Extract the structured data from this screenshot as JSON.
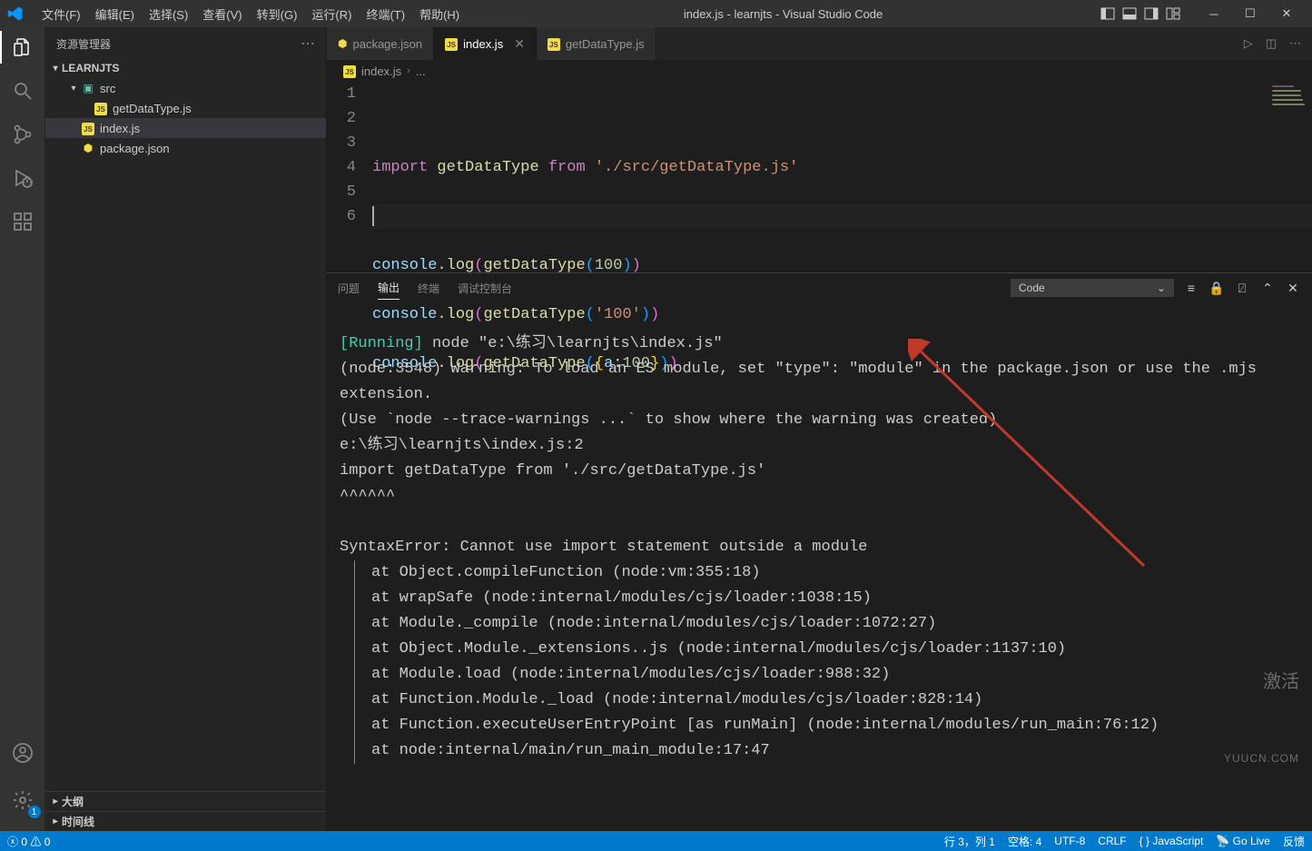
{
  "window": {
    "title": "index.js - learnjts - Visual Studio Code"
  },
  "menu": {
    "items": [
      "文件(F)",
      "编辑(E)",
      "选择(S)",
      "查看(V)",
      "转到(G)",
      "运行(R)",
      "终端(T)",
      "帮助(H)"
    ]
  },
  "sidebar": {
    "title": "资源管理器",
    "project": "LEARNJTS",
    "tree": {
      "folder_src": "src",
      "file_getdatatype": "getDataType.js",
      "file_index": "index.js",
      "file_package": "package.json"
    },
    "outline": "大纲",
    "timeline": "时间线"
  },
  "activity": {
    "settings_badge": "1"
  },
  "tabs": {
    "items": [
      {
        "label": "package.json",
        "active": false,
        "icon": "json"
      },
      {
        "label": "index.js",
        "active": true,
        "icon": "js"
      },
      {
        "label": "getDataType.js",
        "active": false,
        "icon": "js"
      }
    ]
  },
  "breadcrumbs": {
    "segments": [
      "index.js",
      "..."
    ],
    "icon": "js"
  },
  "editor": {
    "line_numbers": [
      "1",
      "2",
      "3",
      "4",
      "5",
      "6"
    ],
    "tokens": {
      "import": "import",
      "getDataType": "getDataType",
      "from": "from",
      "path": "'./src/getDataType.js'",
      "console": "console",
      "log": "log",
      "num100": "100",
      "str100": "'100'",
      "prop_a": "a",
      "colon": ":"
    }
  },
  "panel": {
    "tabs": {
      "problems": "问题",
      "output": "输出",
      "terminal": "终端",
      "debug_console": "调试控制台"
    },
    "select_value": "Code"
  },
  "output": {
    "l1_running": "[Running]",
    "l1_rest": " node \"e:\\练习\\learnjts\\index.js\"",
    "l2": "(node:3548) Warning: To load an ES module, set \"type\": \"module\" in the package.json or use the .mjs extension.",
    "l3": "(Use `node --trace-warnings ...` to show where the warning was created)",
    "l4": "e:\\练习\\learnjts\\index.js:2",
    "l5": "import getDataType from './src/getDataType.js'",
    "l6": "^^^^^^",
    "l8": "SyntaxError: Cannot use import statement outside a module",
    "stack": [
      "at Object.compileFunction (node:vm:355:18)",
      "at wrapSafe (node:internal/modules/cjs/loader:1038:15)",
      "at Module._compile (node:internal/modules/cjs/loader:1072:27)",
      "at Object.Module._extensions..js (node:internal/modules/cjs/loader:1137:10)",
      "at Module.load (node:internal/modules/cjs/loader:988:32)",
      "at Function.Module._load (node:internal/modules/cjs/loader:828:14)",
      "at Function.executeUserEntryPoint [as runMain] (node:internal/modules/run_main:76:12)",
      "at node:internal/main/run_main_module:17:47"
    ]
  },
  "statusbar": {
    "errors": "0",
    "warnings": "0",
    "ln_col": "行 3，列 1",
    "spaces": "空格: 4",
    "encoding": "UTF-8",
    "eol": "CRLF",
    "lang": "JavaScript",
    "golive": "Go Live",
    "feedback": "反馈"
  },
  "watermark": {
    "line1": "激活",
    "line2": "YUUCN.COM"
  }
}
